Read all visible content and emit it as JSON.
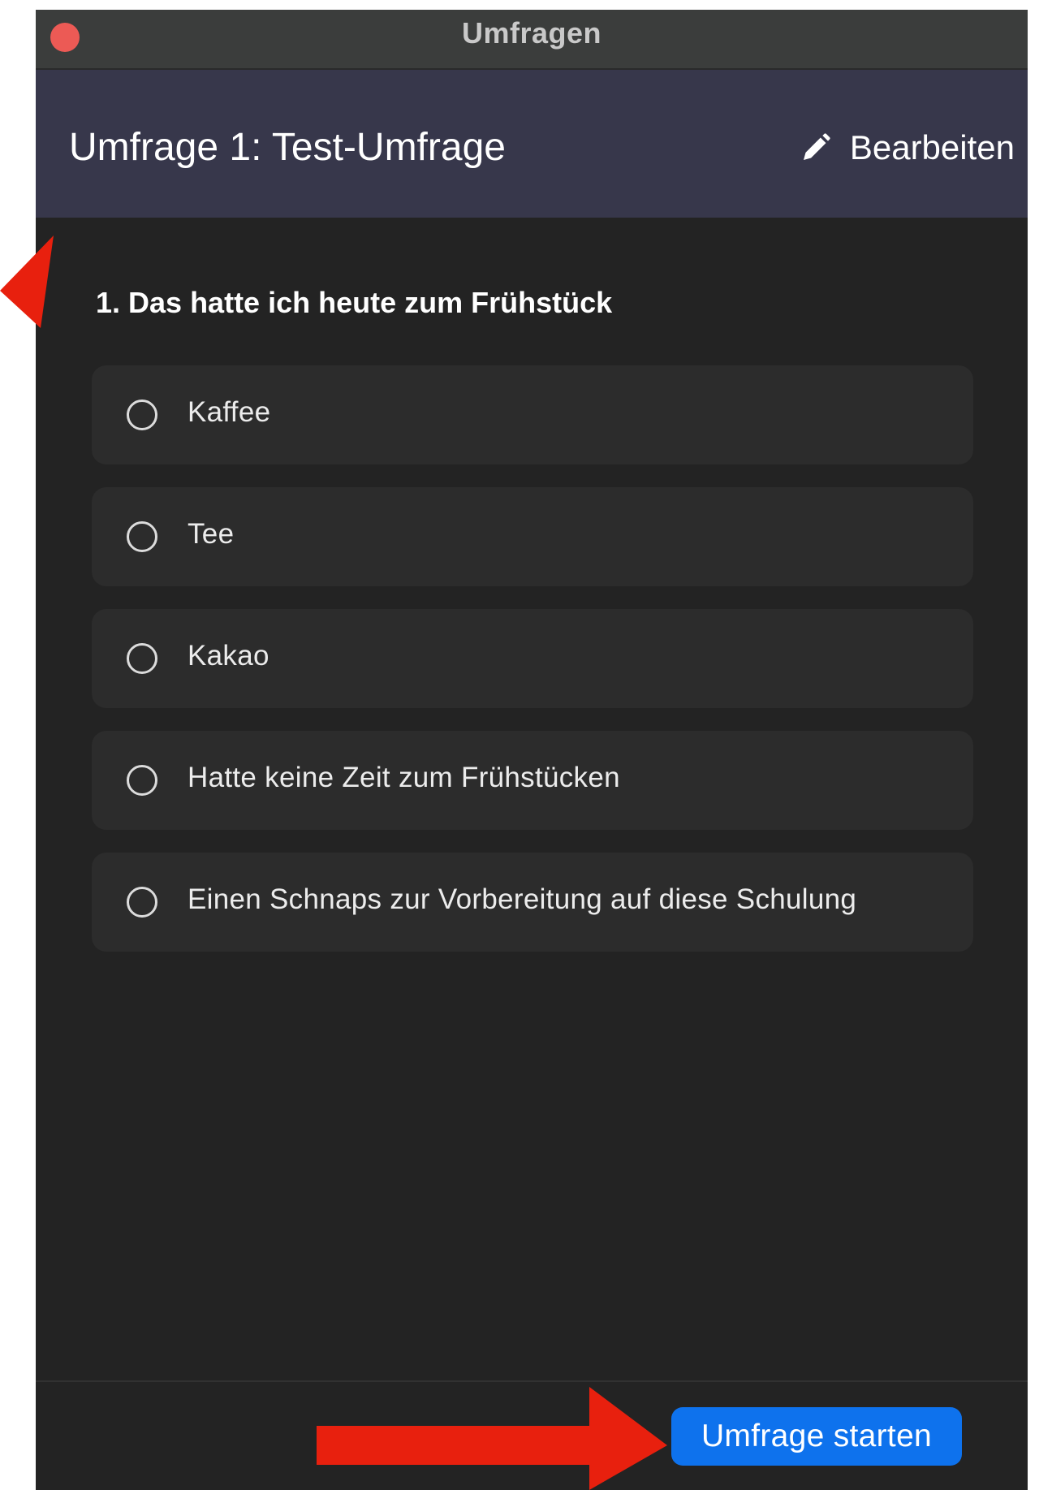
{
  "window": {
    "title": "Umfragen"
  },
  "poll": {
    "title": "Umfrage 1: Test-Umfrage",
    "edit_label": "Bearbeiten",
    "question": "1. Das hatte ich heute zum Frühstück",
    "options": [
      {
        "label": "Kaffee"
      },
      {
        "label": "Tee"
      },
      {
        "label": "Kakao"
      },
      {
        "label": "Hatte keine Zeit zum Frühstücken"
      },
      {
        "label": "Einen Schnaps zur Vorbereitung auf diese Schulung"
      }
    ],
    "start_label": "Umfrage starten"
  },
  "colors": {
    "close_dot": "#ec5a55",
    "header_bg": "#37374b",
    "primary_button": "#0e72ed",
    "annotation_arrow": "#e8200e"
  },
  "icons": {
    "edit": "pencil-icon",
    "option": "radio-icon"
  }
}
